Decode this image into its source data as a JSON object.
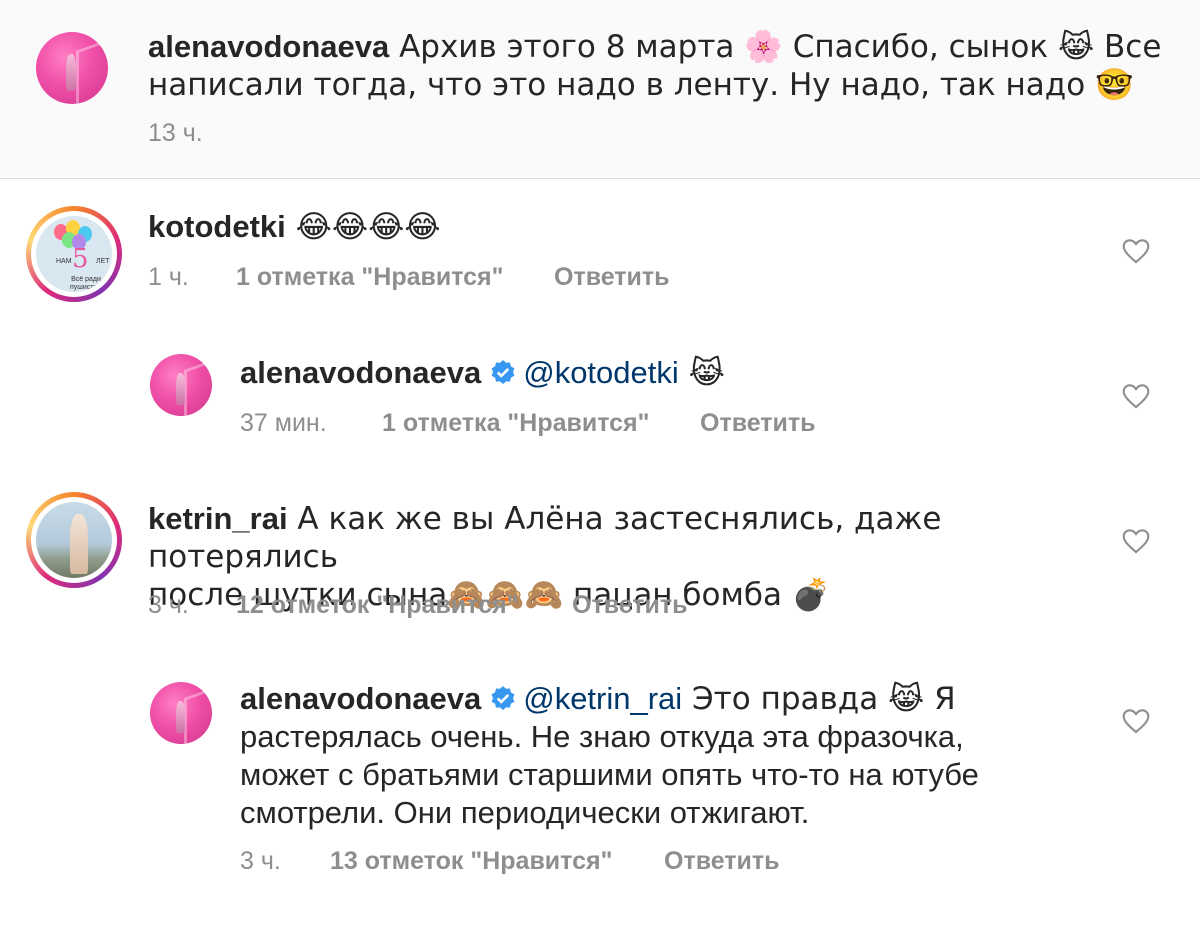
{
  "caption": {
    "username": "alenavodonaeva",
    "text_line1": " Архив этого 8 марта 🌸 Спасибо, сынок 😹 Все",
    "text_line2": "написали тогда, что это надо в ленту. Ну надо, так надо 🤓",
    "time": "13 ч."
  },
  "comments": [
    {
      "username": "kotodetki",
      "text": " 😂😂😂😂",
      "time": "1 ч.",
      "likes": "1 отметка \"Нравится\"",
      "reply_label": "Ответить",
      "avatar_text": {
        "nam": "НАМ",
        "five": "5",
        "let": "ЛЕТ",
        "slogan": "Всё ради пушистых поп"
      }
    },
    {
      "username": "alenavodonaeva",
      "verified": true,
      "mention": "@kotodetki",
      "text": " 😹",
      "time": "37 мин.",
      "likes": "1 отметка \"Нравится\"",
      "reply_label": "Ответить"
    },
    {
      "username": "ketrin_rai",
      "text_line1": " А как же вы Алёна застеснялись, даже потерялись",
      "text_line2": "после шутки сына🙈🙈🙈 пацан бомба 💣",
      "time": "3 ч.",
      "likes": "12 отметок \"Нравится\"",
      "reply_label": "Ответить"
    },
    {
      "username": "alenavodonaeva",
      "verified": true,
      "mention": "@ketrin_rai",
      "text_line1": " Это правда 😹 Я",
      "text_line2": "растерялась очень. Не знаю откуда эта фразочка,",
      "text_line3": "может с братьями старшими опять что-то на ютубе",
      "text_line4": "смотрели. Они периодически отжигают.",
      "time": "3 ч.",
      "likes": "13 отметок \"Нравится\"",
      "reply_label": "Ответить"
    }
  ],
  "colors": {
    "text": "#262626",
    "meta": "#8e8e8e",
    "mention": "#00376b",
    "verified": "#3897f0",
    "avatar_pink": "#f04fa7"
  },
  "icons": [
    "heart-icon",
    "verified-badge-icon"
  ]
}
